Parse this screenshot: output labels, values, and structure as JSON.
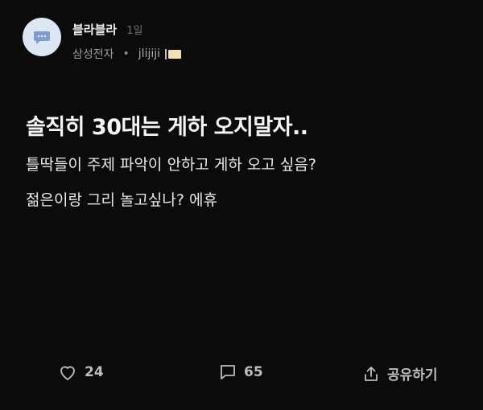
{
  "post": {
    "author": {
      "nickname": "블라블라",
      "time": "1일",
      "company": "삼성전자",
      "separator": "•",
      "user_id": "jlijiji"
    },
    "title": "솔직히 30대는 게하 오지말자..",
    "body": [
      "틀딱들이 주제 파악이 안하고 게하 오고 싶음?",
      "젊은이랑 그리 놀고싶나? 에휴"
    ]
  },
  "actions": {
    "likes": "24",
    "comments": "65",
    "share_label": "공유하기"
  },
  "icons": {
    "avatar": "chat-bubble-icon",
    "like": "heart-icon",
    "comment": "comment-icon",
    "share": "share-icon"
  },
  "colors": {
    "background": "#0b0b0b",
    "avatar_bg": "#dde6f3",
    "avatar_icon": "#7f9ccc",
    "badge": "#f1e2b0"
  }
}
